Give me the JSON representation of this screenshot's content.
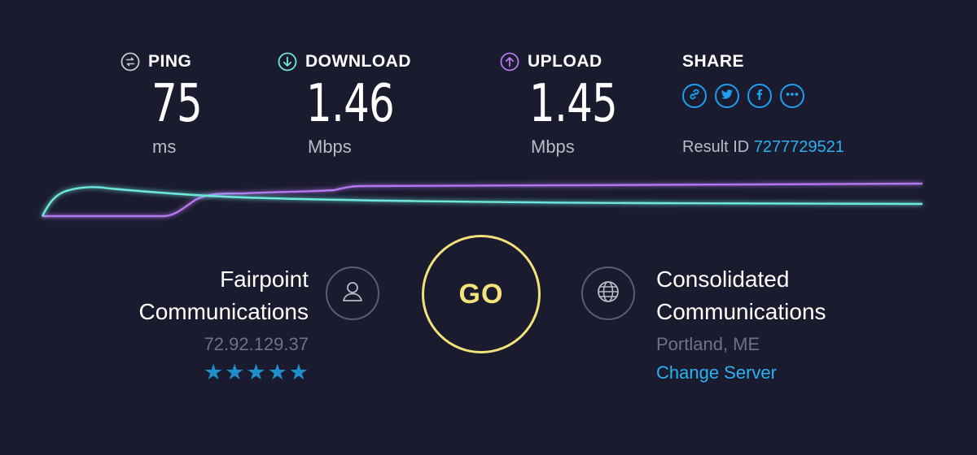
{
  "metrics": {
    "ping": {
      "label": "PING",
      "value": "75",
      "unit": "ms",
      "icon": "ping-icon"
    },
    "download": {
      "label": "DOWNLOAD",
      "value": "1.46",
      "unit": "Mbps",
      "icon": "download-arrow-icon"
    },
    "upload": {
      "label": "UPLOAD",
      "value": "1.45",
      "unit": "Mbps",
      "icon": "upload-arrow-icon"
    }
  },
  "share": {
    "label": "SHARE",
    "buttons": [
      "link-icon",
      "twitter-icon",
      "facebook-icon",
      "more-icon"
    ],
    "result_label": "Result ID",
    "result_id": "7277729521"
  },
  "isp": {
    "name_line1": "Fairpoint",
    "name_line2": "Communications",
    "ip": "72.92.129.37",
    "stars": "★★★★★",
    "rating": 5
  },
  "go_label": "GO",
  "server": {
    "name_line1": "Consolidated",
    "name_line2": "Communications",
    "location": "Portland, ME",
    "change_label": "Change Server"
  },
  "colors": {
    "background": "#1a1b2e",
    "download": "#6ee8dc",
    "upload": "#b477f0",
    "go": "#f2e27a",
    "link": "#2ab1f2",
    "star": "#1f8fc9"
  }
}
